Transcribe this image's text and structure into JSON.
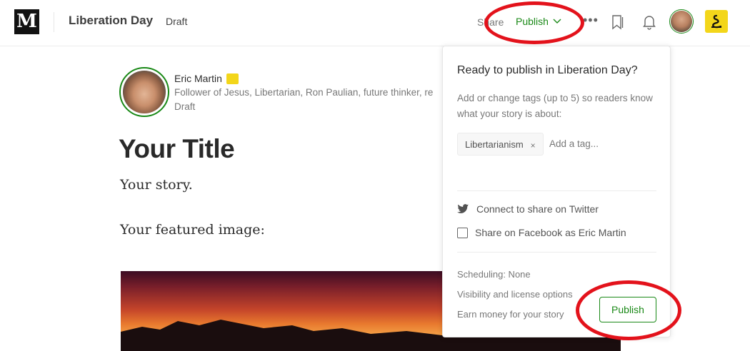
{
  "header": {
    "logo": "M",
    "publication": "Liberation Day",
    "status": "Draft",
    "share_label": "Share",
    "publish_label": "Publish",
    "more_label": "•••"
  },
  "author": {
    "name": "Eric Martin",
    "bio": "Follower of Jesus, Libertarian, Ron Paulian, future thinker, re",
    "status": "Draft"
  },
  "story": {
    "title": "Your Title",
    "body": "Your story.",
    "featured_label": "Your featured image:"
  },
  "publish_panel": {
    "heading": "Ready to publish in Liberation Day?",
    "description": "Add or change tags (up to 5) so readers know what your story is about:",
    "tags": [
      "Libertarianism"
    ],
    "tag_remove": "×",
    "tag_placeholder": "Add a tag...",
    "twitter_label": "Connect to share on Twitter",
    "facebook_label": "Share on Facebook as Eric Martin",
    "facebook_checked": false,
    "scheduling": "Scheduling: None",
    "visibility": "Visibility and license options",
    "earn": "Earn money for your story",
    "publish_button": "Publish"
  },
  "colors": {
    "accent": "#1a8917",
    "annotation": "#e3121b",
    "badge": "#f3d61a"
  }
}
